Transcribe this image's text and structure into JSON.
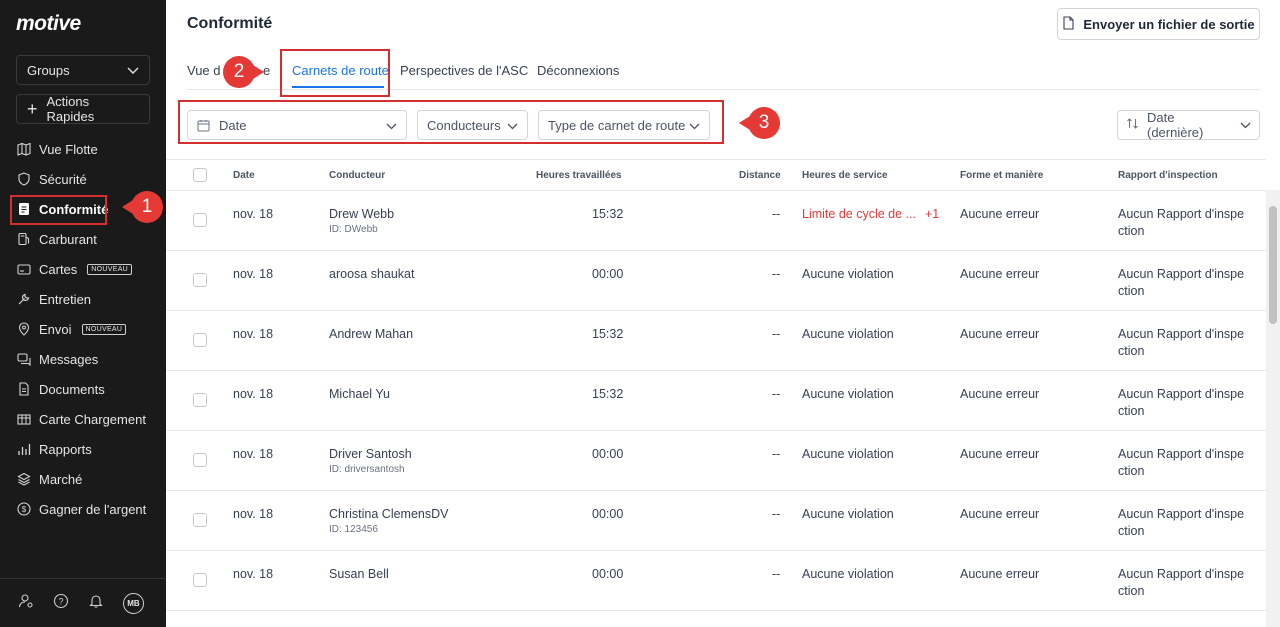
{
  "sidebar": {
    "logo": "motive",
    "groups_label": "Groups",
    "quick_actions_label": "Actions Rapides",
    "items": [
      {
        "label": "Vue Flotte",
        "icon": "map-icon"
      },
      {
        "label": "Sécurité",
        "icon": "shield-icon"
      },
      {
        "label": "Conformité",
        "icon": "clipboard-icon",
        "active": true
      },
      {
        "label": "Carburant",
        "icon": "fuel-icon"
      },
      {
        "label": "Cartes",
        "icon": "card-icon",
        "badge": "NOUVEAU"
      },
      {
        "label": "Entretien",
        "icon": "wrench-icon"
      },
      {
        "label": "Envoi",
        "icon": "dispatch-pin-icon",
        "badge": "NOUVEAU"
      },
      {
        "label": "Messages",
        "icon": "chat-icon"
      },
      {
        "label": "Documents",
        "icon": "document-icon"
      },
      {
        "label": "Carte Chargement",
        "icon": "load-board-icon"
      },
      {
        "label": "Rapports",
        "icon": "bar-chart-icon"
      },
      {
        "label": "Marché",
        "icon": "layers-icon"
      },
      {
        "label": "Gagner de l'argent",
        "icon": "dollar-icon"
      }
    ],
    "footer": {
      "avatar_initials": "MB"
    }
  },
  "header": {
    "title": "Conformité",
    "export_button": "Envoyer un fichier de sortie"
  },
  "tabs": [
    "Vue d'ensemble",
    "Carnets de route",
    "Perspectives de l'ASC",
    "Déconnexions"
  ],
  "tab_visible_fragments": {
    "left": "Vue d",
    "right": "e"
  },
  "active_tab": "Carnets de route",
  "filters": {
    "date": "Date",
    "drivers": "Conducteurs",
    "log_type": "Type de carnet de route",
    "sort": "Date (dernière)"
  },
  "annotations": {
    "m1": "1",
    "m2": "2",
    "m3": "3"
  },
  "table": {
    "columns": [
      "Date",
      "Conducteur",
      "Heures travaillées",
      "Distance",
      "Heures de service",
      "Forme et manière",
      "Rapport d'inspection"
    ],
    "rows": [
      {
        "date": "nov. 18",
        "driver": "Drew Webb",
        "driver_id": "ID: DWebb",
        "hours": "15:32",
        "distance": "--",
        "hos": "Limite de cycle de ...",
        "hos_extra": "+1",
        "hos_violation": true,
        "form": "Aucune erreur",
        "inspection_line1": "Aucun Rapport d'inspe",
        "inspection_line2": "ction"
      },
      {
        "date": "nov. 18",
        "driver": "aroosa shaukat",
        "driver_id": "",
        "hours": "00:00",
        "distance": "--",
        "hos": "Aucune violation",
        "hos_extra": "",
        "hos_violation": false,
        "form": "Aucune erreur",
        "inspection_line1": "Aucun Rapport d'inspe",
        "inspection_line2": "ction"
      },
      {
        "date": "nov. 18",
        "driver": "Andrew Mahan",
        "driver_id": "",
        "hours": "15:32",
        "distance": "--",
        "hos": "Aucune violation",
        "hos_extra": "",
        "hos_violation": false,
        "form": "Aucune erreur",
        "inspection_line1": "Aucun Rapport d'inspe",
        "inspection_line2": "ction"
      },
      {
        "date": "nov. 18",
        "driver": "Michael Yu",
        "driver_id": "",
        "hours": "15:32",
        "distance": "--",
        "hos": "Aucune violation",
        "hos_extra": "",
        "hos_violation": false,
        "form": "Aucune erreur",
        "inspection_line1": "Aucun Rapport d'inspe",
        "inspection_line2": "ction"
      },
      {
        "date": "nov. 18",
        "driver": "Driver Santosh",
        "driver_id": "ID: driversantosh",
        "hours": "00:00",
        "distance": "--",
        "hos": "Aucune violation",
        "hos_extra": "",
        "hos_violation": false,
        "form": "Aucune erreur",
        "inspection_line1": "Aucun Rapport d'inspe",
        "inspection_line2": "ction"
      },
      {
        "date": "nov. 18",
        "driver": "Christina ClemensDV",
        "driver_id": "ID: 123456",
        "hours": "00:00",
        "distance": "--",
        "hos": "Aucune violation",
        "hos_extra": "",
        "hos_violation": false,
        "form": "Aucune erreur",
        "inspection_line1": "Aucun Rapport d'inspe",
        "inspection_line2": "ction"
      },
      {
        "date": "nov. 18",
        "driver": "Susan Bell",
        "driver_id": "",
        "hours": "00:00",
        "distance": "--",
        "hos": "Aucune violation",
        "hos_extra": "",
        "hos_violation": false,
        "form": "Aucune erreur",
        "inspection_line1": "Aucun Rapport d'inspe",
        "inspection_line2": "ction"
      }
    ]
  },
  "colors": {
    "accent": "#1a73e8",
    "violation": "#e03b3b",
    "annotation": "#e53935",
    "sidebar": "#1a1a1a"
  }
}
